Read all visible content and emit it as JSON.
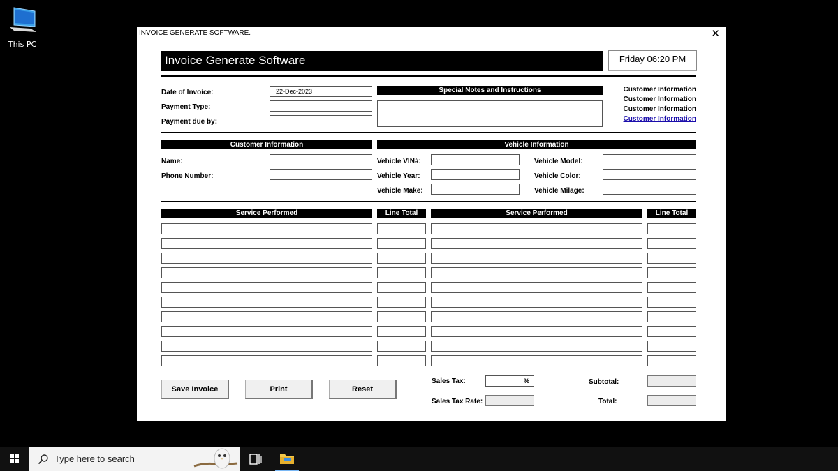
{
  "desktop": {
    "icon_label": "This PC"
  },
  "window": {
    "title": "INVOICE GENERATE SOFTWARE.",
    "close": "✕"
  },
  "app": {
    "title": "Invoice Generate Software",
    "time": "Friday 06:20 PM"
  },
  "invoice": {
    "date_label": "Date of Invoice:",
    "date_value": "22-Dec-2023",
    "payment_type_label": "Payment Type:",
    "payment_type_value": "",
    "payment_due_label": "Payment due by:",
    "payment_due_value": "",
    "notes_header": "Special Notes and Instructions",
    "notes_value": ""
  },
  "customer_links": [
    "Customer Information",
    "Customer Information",
    "Customer Information",
    "Customer Information"
  ],
  "customer": {
    "header": "Customer Information",
    "name_label": "Name:",
    "phone_label": "Phone Number:"
  },
  "vehicle": {
    "header": "Vehicle Information",
    "vin_label": "Vehicle VIN#:",
    "year_label": "Vehicle Year:",
    "make_label": "Vehicle Make:",
    "model_label": "Vehicle Model:",
    "color_label": "Vehicle Color:",
    "milage_label": "Vehicle Milage:"
  },
  "services": {
    "header_left": "Service Performed",
    "header_total_left": "Line Total",
    "header_right": "Service Performed",
    "header_total_right": "Line Total",
    "rows": 10
  },
  "totals": {
    "sales_tax_label": "Sales Tax:",
    "sales_tax_value": "%",
    "sales_tax_rate_label": "Sales Tax Rate:",
    "subtotal_label": "Subtotal:",
    "total_label": "Total:"
  },
  "buttons": {
    "save": "Save Invoice",
    "print": "Print",
    "reset": "Reset"
  },
  "taskbar": {
    "search_placeholder": "Type here to search"
  },
  "colors": {
    "desktop_bg": "#000000",
    "header_bg": "#000000",
    "link": "#1a0dab",
    "taskbar": "#111111"
  }
}
